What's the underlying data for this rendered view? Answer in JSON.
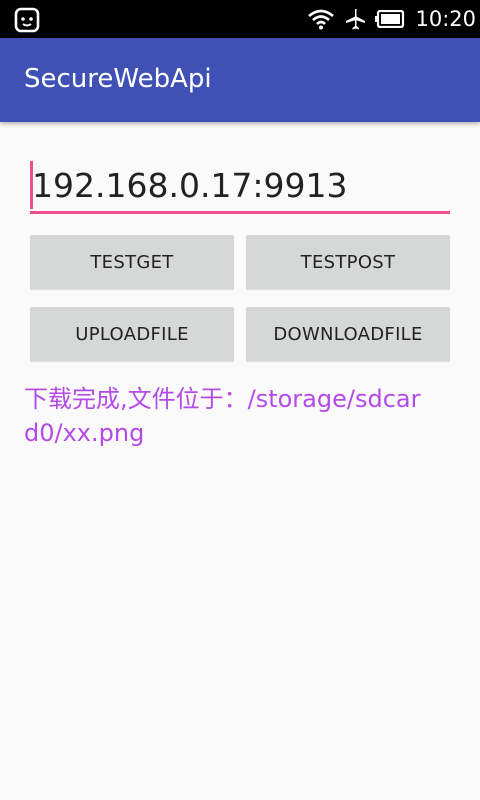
{
  "status_bar": {
    "time": "10:20",
    "icons": [
      "app-notification-icon",
      "wifi-icon",
      "airplane-icon",
      "battery-icon"
    ]
  },
  "app_bar": {
    "title": "SecureWebApi",
    "color": "#3f51b5"
  },
  "form": {
    "url_value": "192.168.0.17:9913",
    "accent_color": "#ef4f8b"
  },
  "buttons": {
    "testget": "TESTGET",
    "testpost": "TESTPOST",
    "uploadfile": "UPLOADFILE",
    "downloadfile": "DOWNLOADFILE"
  },
  "result": {
    "text": "下载完成,文件位于：/storage/sdcard0/xx.png",
    "color": "#b44be7"
  }
}
